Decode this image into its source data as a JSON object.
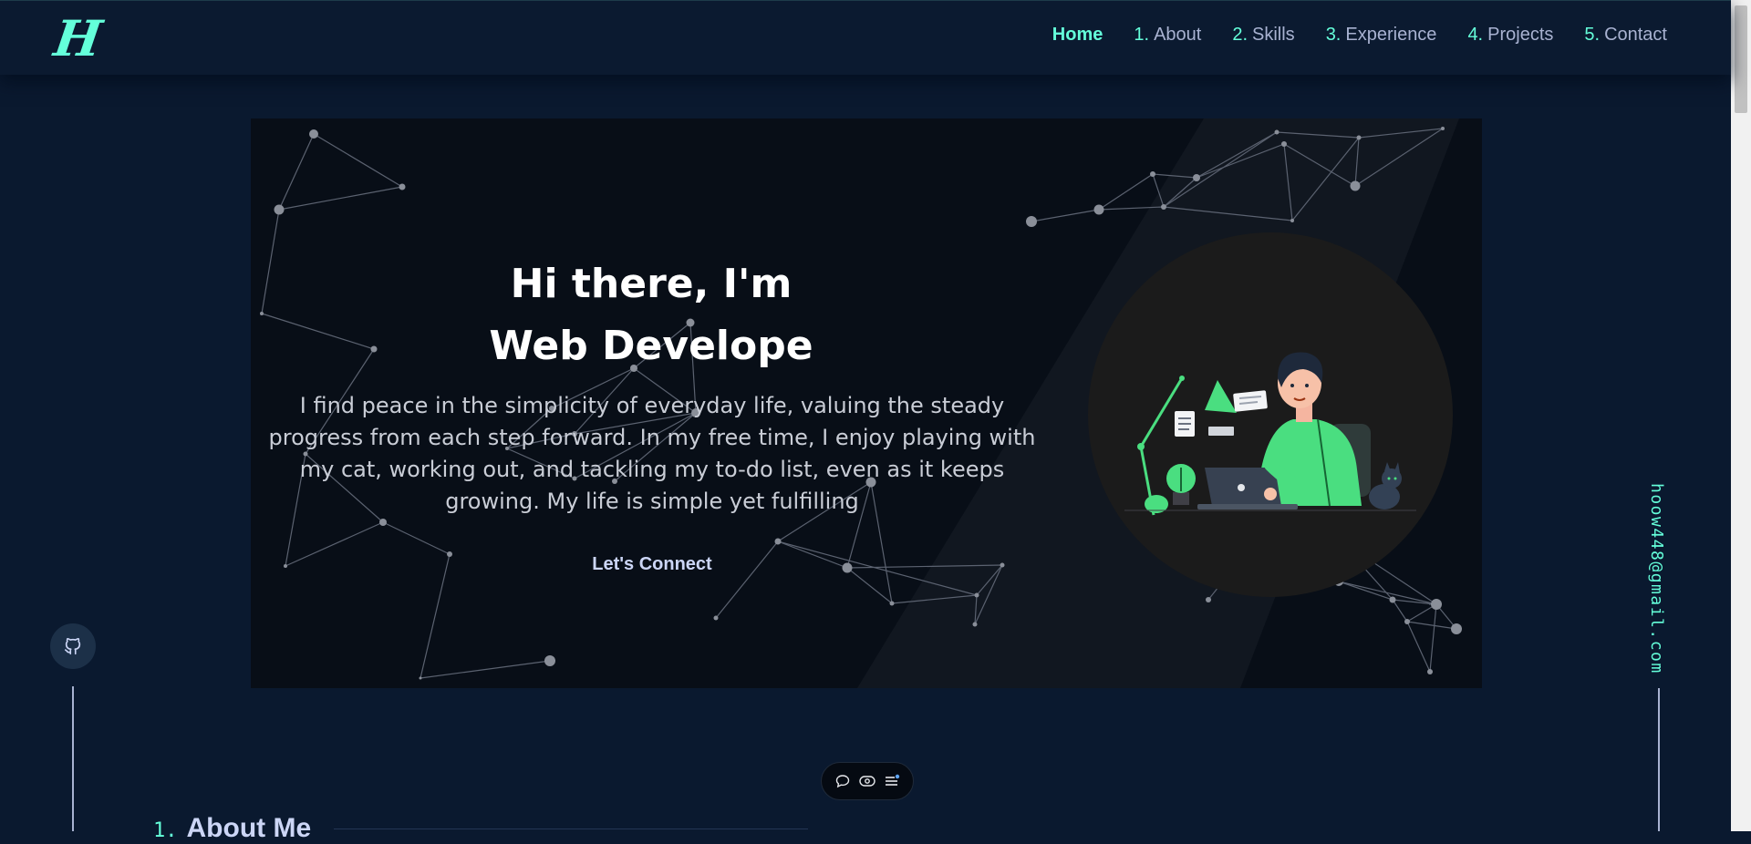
{
  "logo": {
    "text": "H"
  },
  "nav": {
    "items": [
      {
        "num": "",
        "label": "Home",
        "active": true
      },
      {
        "num": "1.",
        "label": "About"
      },
      {
        "num": "2.",
        "label": "Skills"
      },
      {
        "num": "3.",
        "label": "Experience"
      },
      {
        "num": "4.",
        "label": "Projects"
      },
      {
        "num": "5.",
        "label": "Contact"
      }
    ]
  },
  "hero": {
    "title_line1": "Hi there, I'm",
    "title_line2": "Web Develope",
    "description": "I find peace in the simplicity of everyday life, valuing the steady progress from each step forward. In my free time, I enjoy playing with my cat, working out, and tackling my to-do list, even as it keeps growing. My life is simple yet fulfilling",
    "connect_label": "Let's Connect",
    "illustration": "developer-at-laptop-illustration"
  },
  "social": {
    "github_icon": "github-icon"
  },
  "email": "hoow448@gmail.com",
  "toolbar": {
    "icons": [
      "chat-bubble-icon",
      "eye-icon",
      "list-menu-icon"
    ]
  },
  "about": {
    "num": "1.",
    "title": "About Me"
  },
  "colors": {
    "accent": "#64ffda",
    "background": "#0a192f",
    "hero_bg": "#080e17",
    "text": "#ccd6f6",
    "illustration_green": "#4ade80"
  }
}
